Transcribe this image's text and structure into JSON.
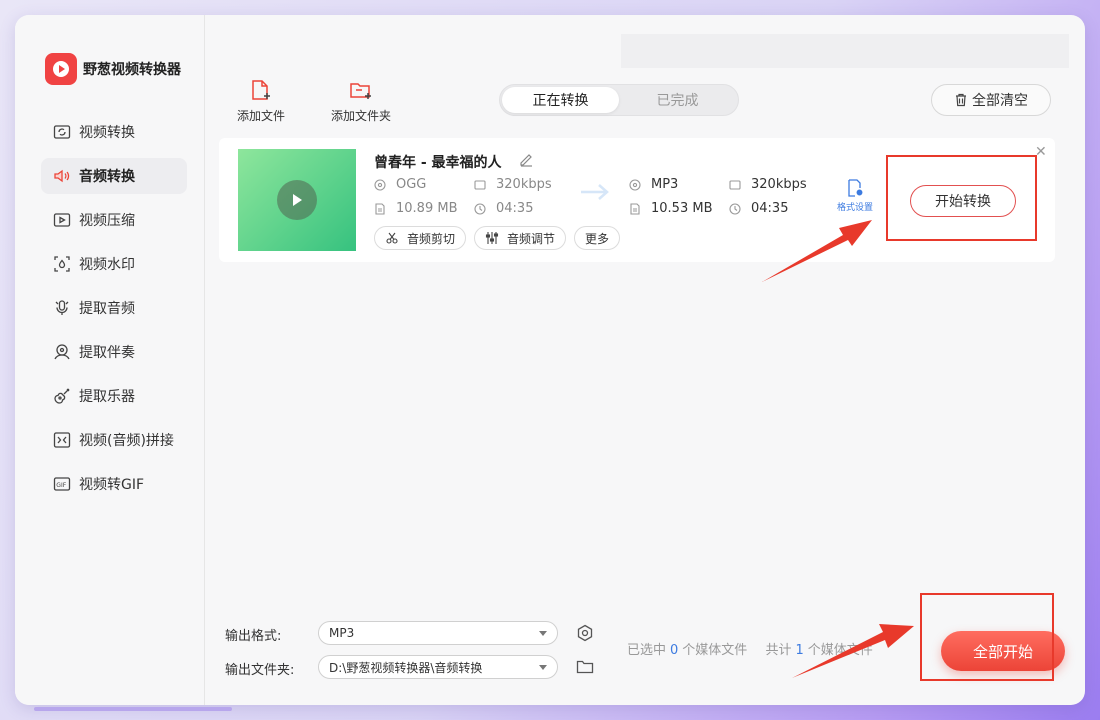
{
  "app": {
    "name": "野葱视频转换器"
  },
  "sidebar": {
    "items": [
      {
        "label": "视频转换",
        "icon": "video-convert-icon"
      },
      {
        "label": "音频转换",
        "icon": "audio-convert-icon",
        "active": true
      },
      {
        "label": "视频压缩",
        "icon": "video-compress-icon"
      },
      {
        "label": "视频水印",
        "icon": "video-watermark-icon"
      },
      {
        "label": "提取音频",
        "icon": "extract-audio-icon"
      },
      {
        "label": "提取伴奏",
        "icon": "extract-accompaniment-icon"
      },
      {
        "label": "提取乐器",
        "icon": "extract-instrument-icon"
      },
      {
        "label": "视频(音频)拼接",
        "icon": "merge-icon"
      },
      {
        "label": "视频转GIF",
        "icon": "gif-icon"
      }
    ]
  },
  "toolbar": {
    "add_file": "添加文件",
    "add_folder": "添加文件夹",
    "tab_converting": "正在转换",
    "tab_done": "已完成",
    "clear_all": "全部清空"
  },
  "file": {
    "title": "曾春年 - 最幸福的人",
    "source": {
      "format": "OGG",
      "bitrate": "320kbps",
      "size": "10.89 MB",
      "duration": "04:35"
    },
    "target": {
      "format": "MP3",
      "bitrate": "320kbps",
      "size": "10.53 MB",
      "duration": "04:35"
    },
    "format_settings": "格式设置",
    "actions": {
      "cut": "音频剪切",
      "adjust": "音频调节",
      "more": "更多"
    },
    "start_label": "开始转换",
    "close_symbol": "✕"
  },
  "bottom": {
    "output_format_label": "输出格式:",
    "output_format_value": "MP3",
    "output_folder_label": "输出文件夹:",
    "output_folder_value": "D:\\野葱视频转换器\\音频转换",
    "selected_prefix": "已选中",
    "selected_count": "0",
    "selected_suffix": "个媒体文件",
    "total_prefix": "共计",
    "total_count": "1",
    "total_suffix": "个媒体文件",
    "start_all": "全部开始"
  },
  "colors": {
    "accent_red": "#ec4438",
    "annotation_red": "#e8392b",
    "link_blue": "#3d7be0"
  }
}
